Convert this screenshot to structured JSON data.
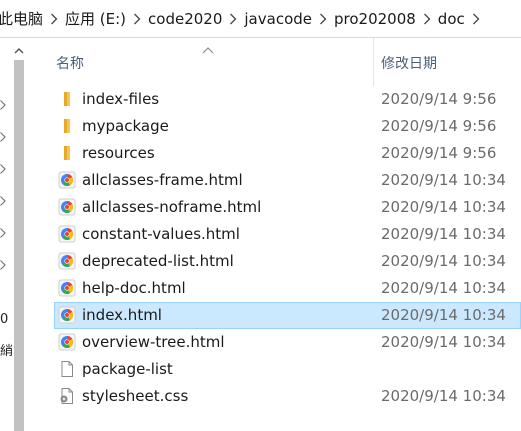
{
  "breadcrumb": {
    "items": [
      "此电脑",
      "应用 (E:)",
      "code2020",
      "javacode",
      "pro202008",
      "doc"
    ]
  },
  "columns": {
    "name": "名称",
    "date_modified": "修改日期"
  },
  "files": [
    {
      "name": "index-files",
      "date": "2020/9/14 9:56",
      "type": "folder"
    },
    {
      "name": "mypackage",
      "date": "2020/9/14 9:56",
      "type": "folder"
    },
    {
      "name": "resources",
      "date": "2020/9/14 9:56",
      "type": "folder"
    },
    {
      "name": "allclasses-frame.html",
      "date": "2020/9/14 10:34",
      "type": "html"
    },
    {
      "name": "allclasses-noframe.html",
      "date": "2020/9/14 10:34",
      "type": "html"
    },
    {
      "name": "constant-values.html",
      "date": "2020/9/14 10:34",
      "type": "html"
    },
    {
      "name": "deprecated-list.html",
      "date": "2020/9/14 10:34",
      "type": "html"
    },
    {
      "name": "help-doc.html",
      "date": "2020/9/14 10:34",
      "type": "html"
    },
    {
      "name": "index.html",
      "date": "2020/9/14 10:34",
      "type": "html",
      "selected": true
    },
    {
      "name": "overview-tree.html",
      "date": "2020/9/14 10:34",
      "type": "html"
    },
    {
      "name": "package-list",
      "date": "",
      "type": "file"
    },
    {
      "name": "stylesheet.css",
      "date": "2020/9/14 10:34",
      "type": "css"
    }
  ],
  "nav_fragments": [
    "0",
    "綃"
  ],
  "colors": {
    "selected_bg": "#cce8ff",
    "selected_border": "#99d1ff",
    "folder": "#f8c64a",
    "header_text": "#4c607a"
  }
}
